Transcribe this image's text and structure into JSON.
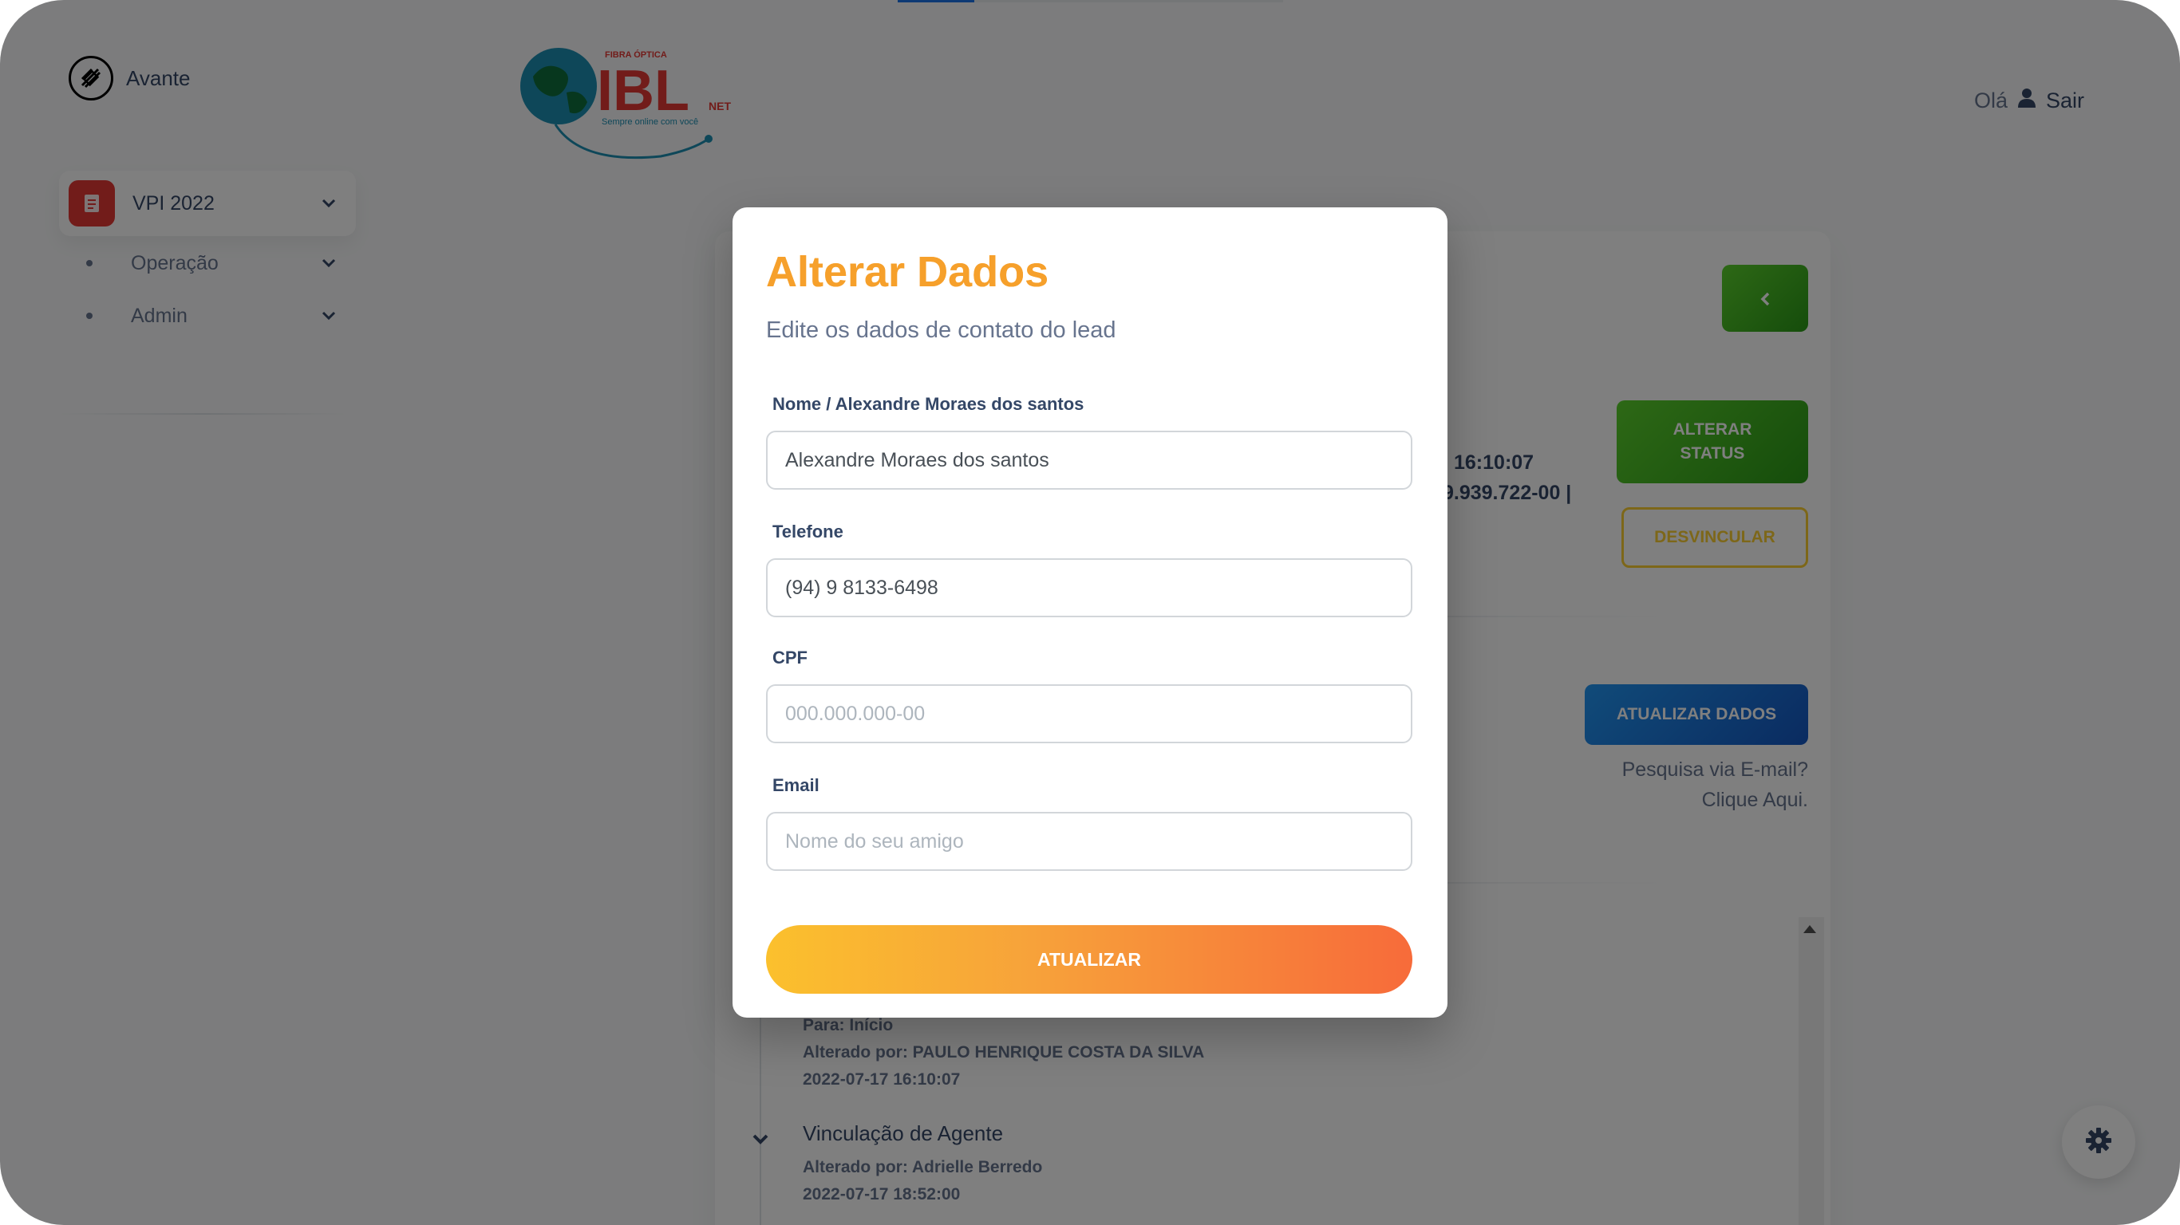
{
  "sidebar": {
    "brand": "Avante",
    "main_item": "VPI 2022",
    "sub_items": [
      {
        "label": "Operação"
      },
      {
        "label": "Admin"
      }
    ]
  },
  "header": {
    "logo_top": "FIBRA ÓPTICA",
    "logo_main": "IBL",
    "logo_net": "NET",
    "logo_tagline": "Sempre online com você",
    "greeting": "Olá",
    "logout": "Sair"
  },
  "main": {
    "back_icon": "chevron-left-icon",
    "alterar_status": "ALTERAR STATUS",
    "desvincular": "DESVINCULAR",
    "info_time": "16:10:07",
    "info_doc": "9.939.722-00 |",
    "atualizar_dados": "ATUALIZAR DADOS",
    "search_email_line1": "Pesquisa via E-mail?",
    "search_email_line2": "Clique Aqui.",
    "timeline": [
      {
        "line1": "Para: Início",
        "line2": "Alterado por: PAULO HENRIQUE COSTA DA SILVA",
        "line3": "2022-07-17 16:10:07"
      },
      {
        "title": "Vinculação de Agente",
        "line2": "Alterado por: Adrielle Berredo",
        "line3": "2022-07-17 18:52:00"
      }
    ]
  },
  "modal": {
    "title": "Alterar Dados",
    "subtitle": "Edite os dados de contato do lead",
    "fields": {
      "nome_label": "Nome / Alexandre Moraes dos santos",
      "nome_value": "Alexandre Moraes dos santos",
      "telefone_label": "Telefone",
      "telefone_value": "(94) 9 8133-6498",
      "cpf_label": "CPF",
      "cpf_placeholder": "000.000.000-00",
      "email_label": "Email",
      "email_placeholder": "Nome do seu amigo"
    },
    "submit": "ATUALIZAR"
  },
  "colors": {
    "accent_orange": "#f6a02b",
    "green": "#3bb31f",
    "blue": "#1a73e8",
    "yellow": "#fbcf33",
    "red": "#e53935"
  }
}
